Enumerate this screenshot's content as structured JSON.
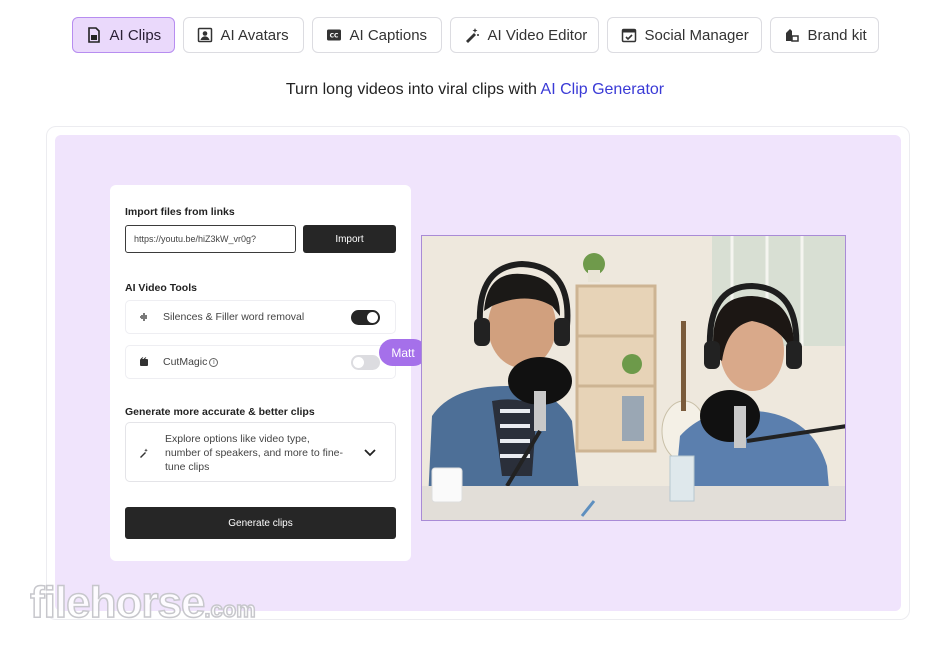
{
  "tabs": [
    {
      "label": "AI Clips",
      "icon": "file-clip-icon",
      "active": true
    },
    {
      "label": "AI Avatars",
      "icon": "avatar-portrait-icon",
      "active": false
    },
    {
      "label": "AI Captions",
      "icon": "cc-captions-icon",
      "active": false
    },
    {
      "label": "AI Video Editor",
      "icon": "magic-wand-icon",
      "active": false
    },
    {
      "label": "Social Manager",
      "icon": "calendar-check-icon",
      "active": false
    },
    {
      "label": "Brand kit",
      "icon": "brand-kit-icon",
      "active": false
    }
  ],
  "tagline": {
    "text": "Turn long videos into viral clips with ",
    "link": "AI Clip Generator"
  },
  "panel": {
    "import_heading": "Import files from links",
    "url_value": "https://youtu.be/hiZ3kW_vr0g?",
    "import_button": "Import",
    "tools_heading": "AI Video Tools",
    "tools": [
      {
        "label": "Silences & Filler word removal",
        "icon": "audio-wave-icon",
        "enabled": true
      },
      {
        "label": "CutMagic",
        "icon": "scissors-magic-icon",
        "enabled": false,
        "info": "i"
      }
    ],
    "generate_heading": "Generate more accurate & better clips",
    "options_text": "Explore options like video type, number of speakers, and more to fine-tune clips",
    "generate_button": "Generate clips"
  },
  "collaborator": {
    "name": "Matt"
  },
  "watermark": {
    "main": "filehorse",
    "suffix": ".com"
  },
  "colors": {
    "accent": "#a570ea",
    "active_tab_bg": "#ead9fb",
    "stage_bg": "#f0e4fc",
    "link": "#3a3ad6",
    "dark_button": "#262626"
  }
}
